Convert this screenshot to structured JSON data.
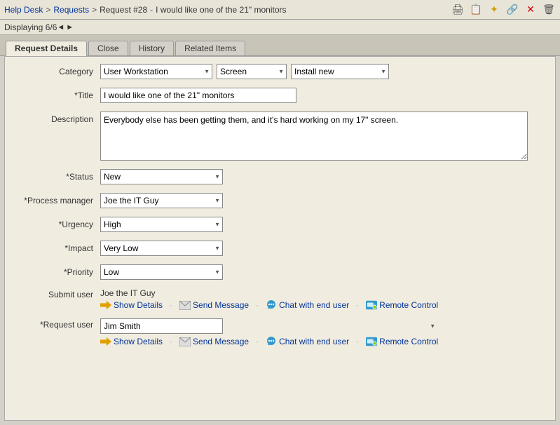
{
  "breadcrumb": {
    "part1": "Help Desk",
    "sep1": ">",
    "part2": "Requests",
    "sep2": ">",
    "part3": "Request #28",
    "sep3": "-",
    "part4": "I would like one of the 21\" monitors"
  },
  "display": {
    "label": "Displaying 6/6"
  },
  "tabs": {
    "request_details": "Request Details",
    "close": "Close",
    "history": "History",
    "related_items": "Related Items"
  },
  "form": {
    "category_label": "Category",
    "category1_value": "User Workstation",
    "category2_value": "Screen",
    "category3_value": "Install new",
    "title_label": "*Title",
    "title_value": "I would like one of the 21\" monitors",
    "title_placeholder": "",
    "description_label": "Description",
    "description_value": "Everybody else has been getting them, and it's hard working on my 17\" screen.",
    "status_label": "*Status",
    "status_value": "New",
    "process_manager_label": "*Process manager",
    "process_manager_value": "Joe the IT Guy",
    "urgency_label": "*Urgency",
    "urgency_value": "High",
    "impact_label": "*Impact",
    "impact_value": "Very Low",
    "priority_label": "*Priority",
    "priority_value": "Low",
    "submit_user_label": "Submit user",
    "submit_user_name": "Joe the IT Guy",
    "request_user_label": "*Request user",
    "request_user_value": "Jim Smith"
  },
  "actions": {
    "show_details": "Show Details",
    "send_message": "Send Message",
    "chat_with_end_user": "Chat with end user",
    "remote_control": "Remote Control"
  },
  "icons": {
    "print": "🖨",
    "copy": "📋",
    "star": "✦",
    "link": "🔗",
    "close_x": "✕",
    "trash": "🗑",
    "nav_prev": "◄",
    "nav_next": "►"
  }
}
